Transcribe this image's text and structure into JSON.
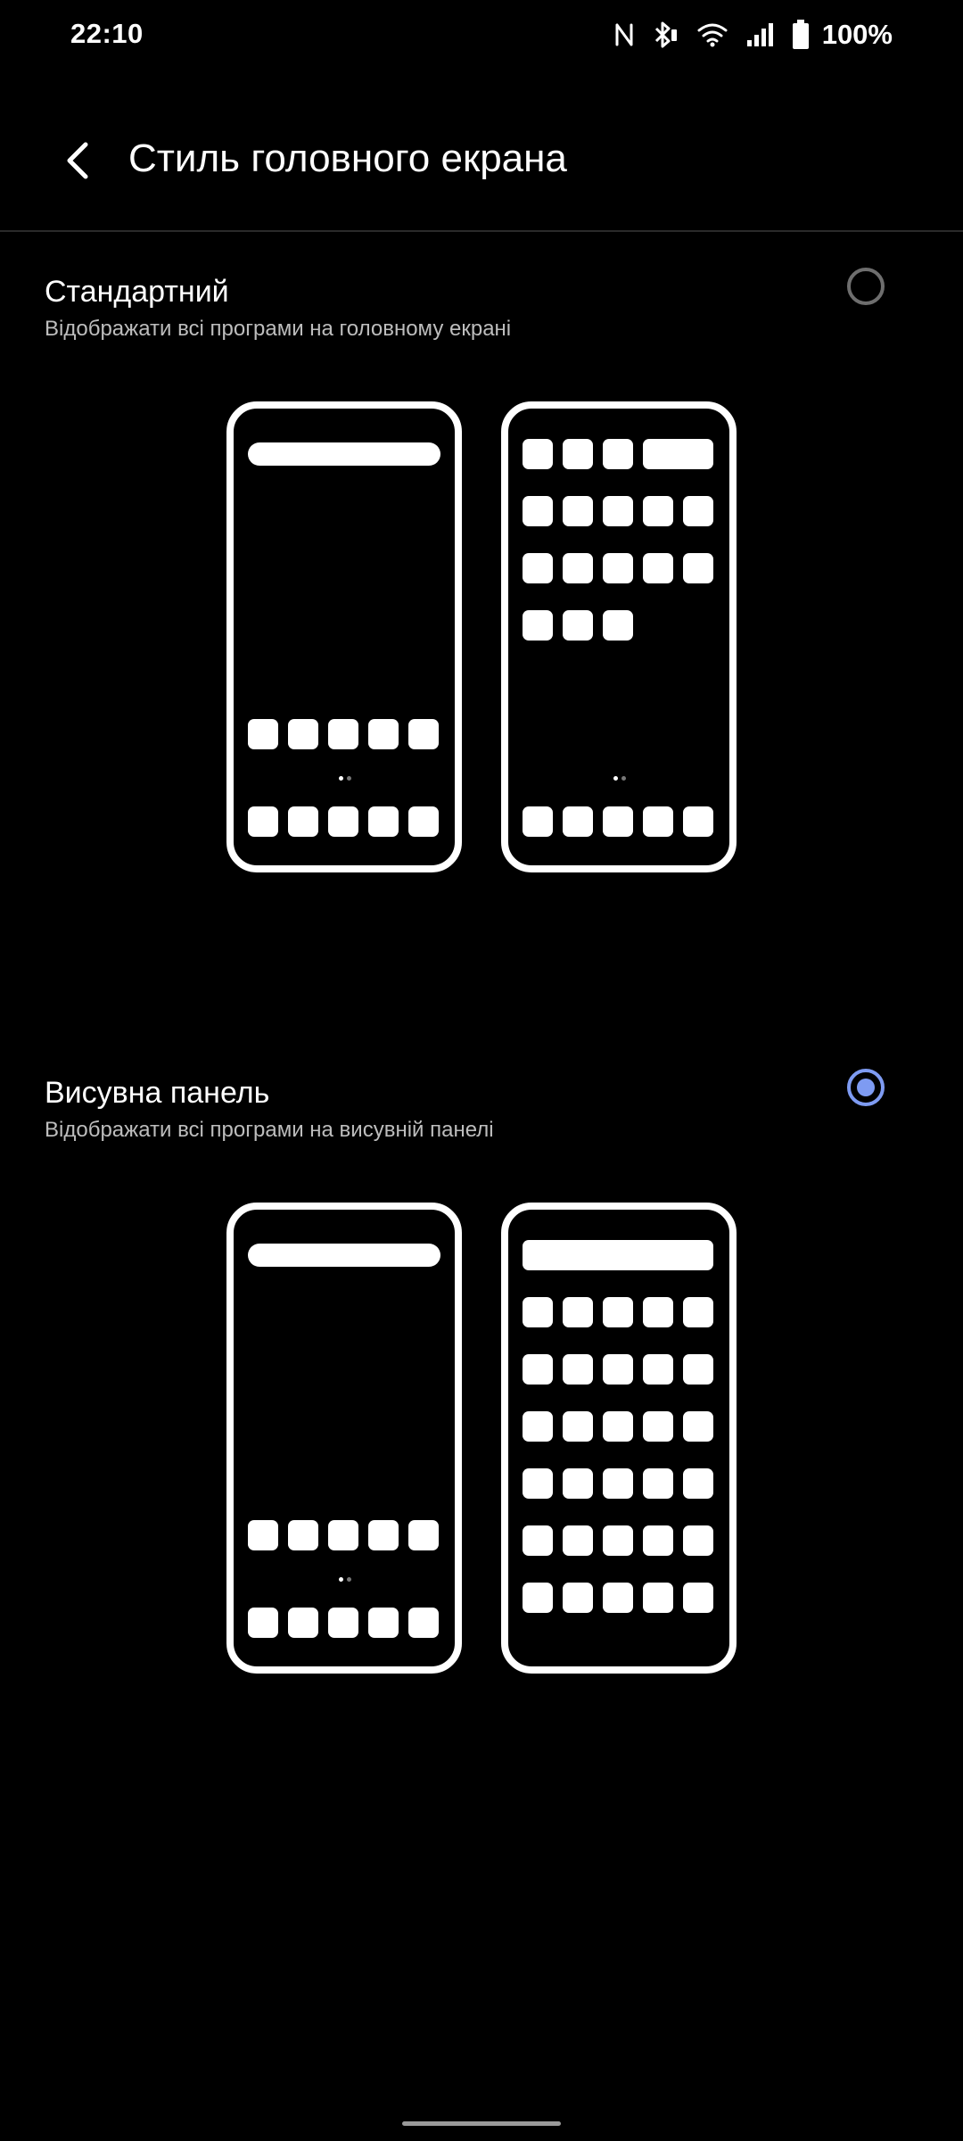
{
  "status_bar": {
    "time": "22:10",
    "battery_percent": "100%",
    "icons": [
      "nfc-icon",
      "bluetooth-icon",
      "wifi-icon",
      "signal-icon",
      "battery-icon"
    ]
  },
  "app_bar": {
    "back_icon": "back-arrow-icon",
    "title": "Стиль головного екрана"
  },
  "options": [
    {
      "title": "Стандартний",
      "description": "Відображати всі програми на головному екрані",
      "selected": false
    },
    {
      "title": "Висувна панель",
      "description": "Відображати всі програми на висувній панелі",
      "selected": true
    }
  ],
  "colors": {
    "background": "#000000",
    "text_primary": "#ffffff",
    "text_secondary": "#bdbdbd",
    "accent": "#7e9bf2",
    "radio_off": "#6e6e6e"
  }
}
